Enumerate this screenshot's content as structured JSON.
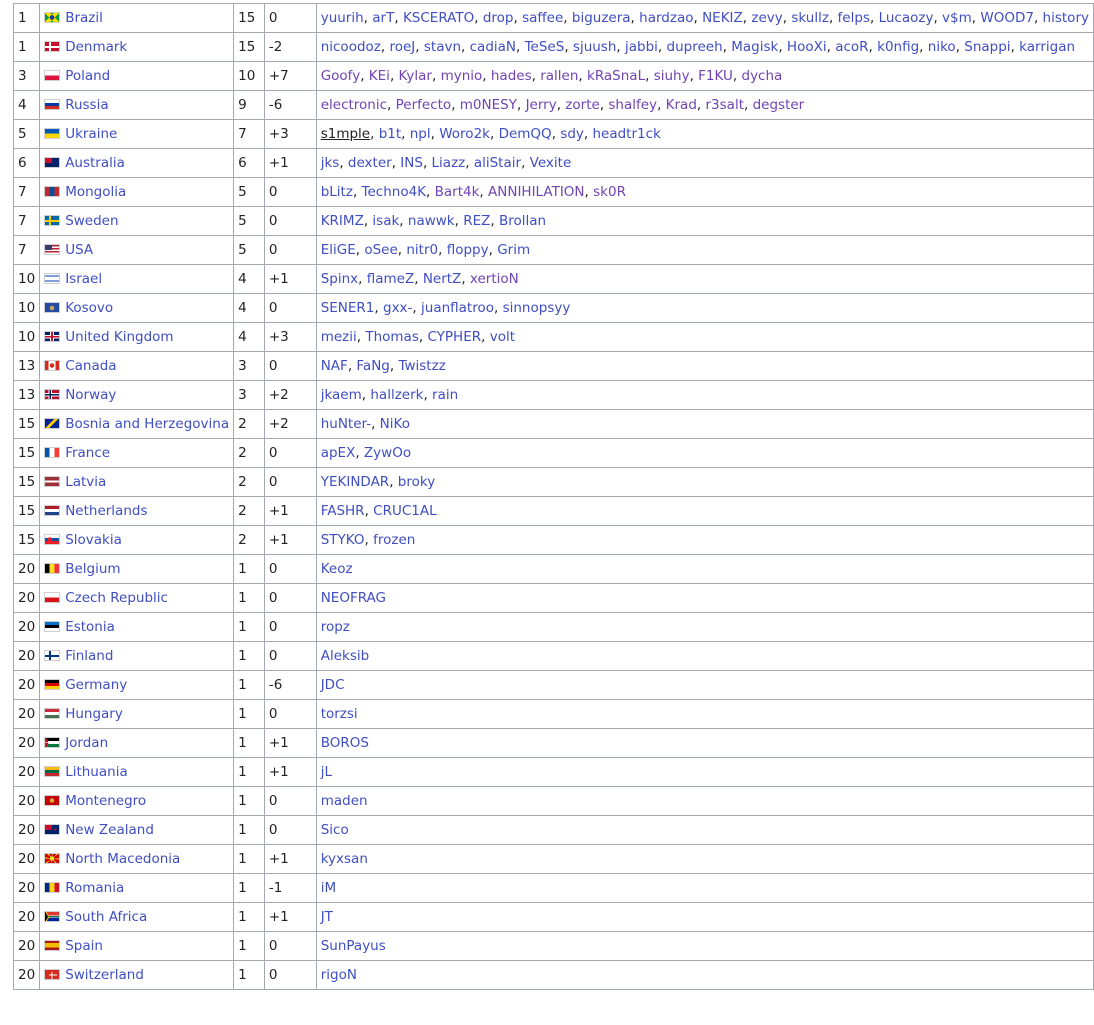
{
  "rows": [
    {
      "rank": "1",
      "country": "Brazil",
      "count": "15",
      "change": "0",
      "flag": "br",
      "players": [
        {
          "name": "yuurih"
        },
        {
          "name": "arT"
        },
        {
          "name": "KSCERATO"
        },
        {
          "name": "drop"
        },
        {
          "name": "saffee"
        },
        {
          "name": "biguzera"
        },
        {
          "name": "hardzao"
        },
        {
          "name": "NEKIZ"
        },
        {
          "name": "zevy"
        },
        {
          "name": "skullz"
        },
        {
          "name": "felps"
        },
        {
          "name": "Lucaozy"
        },
        {
          "name": "v$m"
        },
        {
          "name": "WOOD7"
        },
        {
          "name": "history"
        }
      ]
    },
    {
      "rank": "1",
      "country": "Denmark",
      "count": "15",
      "change": "-2",
      "flag": "dk",
      "players": [
        {
          "name": "nicoodoz"
        },
        {
          "name": "roeJ"
        },
        {
          "name": "stavn"
        },
        {
          "name": "cadiaN"
        },
        {
          "name": "TeSeS"
        },
        {
          "name": "sjuush"
        },
        {
          "name": "jabbi"
        },
        {
          "name": "dupreeh"
        },
        {
          "name": "Magisk"
        },
        {
          "name": "HooXi"
        },
        {
          "name": "acoR"
        },
        {
          "name": "k0nfig"
        },
        {
          "name": "niko"
        },
        {
          "name": "Snappi"
        },
        {
          "name": "karrigan"
        }
      ]
    },
    {
      "rank": "3",
      "country": "Poland",
      "count": "10",
      "change": "+7",
      "flag": "pl",
      "players": [
        {
          "name": "Goofy",
          "state": "visited"
        },
        {
          "name": "KEi",
          "state": "visited"
        },
        {
          "name": "Kylar",
          "state": "visited"
        },
        {
          "name": "mynio",
          "state": "visited"
        },
        {
          "name": "hades",
          "state": "visited"
        },
        {
          "name": "rallen",
          "state": "visited"
        },
        {
          "name": "kRaSnaL",
          "state": "visited"
        },
        {
          "name": "siuhy",
          "state": "visited"
        },
        {
          "name": "F1KU",
          "state": "visited"
        },
        {
          "name": "dycha",
          "state": "visited"
        }
      ]
    },
    {
      "rank": "4",
      "country": "Russia",
      "count": "9",
      "change": "-6",
      "flag": "ru",
      "players": [
        {
          "name": "electronic",
          "state": "visited"
        },
        {
          "name": "Perfecto",
          "state": "visited"
        },
        {
          "name": "m0NESY",
          "state": "visited"
        },
        {
          "name": "Jerry",
          "state": "visited"
        },
        {
          "name": "zorte",
          "state": "visited"
        },
        {
          "name": "shalfey",
          "state": "visited"
        },
        {
          "name": "Krad",
          "state": "visited"
        },
        {
          "name": "r3salt",
          "state": "visited"
        },
        {
          "name": "degster",
          "state": "visited"
        }
      ]
    },
    {
      "rank": "5",
      "country": "Ukraine",
      "count": "7",
      "change": "+3",
      "flag": "ua",
      "players": [
        {
          "name": "s1mple",
          "state": "hovered"
        },
        {
          "name": "b1t"
        },
        {
          "name": "npl"
        },
        {
          "name": "Woro2k"
        },
        {
          "name": "DemQQ"
        },
        {
          "name": "sdy"
        },
        {
          "name": "headtr1ck"
        }
      ]
    },
    {
      "rank": "6",
      "country": "Australia",
      "count": "6",
      "change": "+1",
      "flag": "au",
      "players": [
        {
          "name": "jks"
        },
        {
          "name": "dexter"
        },
        {
          "name": "INS"
        },
        {
          "name": "Liazz"
        },
        {
          "name": "aliStair"
        },
        {
          "name": "Vexite"
        }
      ]
    },
    {
      "rank": "7",
      "country": "Mongolia",
      "count": "5",
      "change": "0",
      "flag": "mn",
      "players": [
        {
          "name": "bLitz"
        },
        {
          "name": "Techno4K"
        },
        {
          "name": "Bart4k",
          "state": "visited"
        },
        {
          "name": "ANNIHILATION",
          "state": "visited"
        },
        {
          "name": "sk0R",
          "state": "visited"
        }
      ]
    },
    {
      "rank": "7",
      "country": "Sweden",
      "count": "5",
      "change": "0",
      "flag": "se",
      "players": [
        {
          "name": "KRIMZ"
        },
        {
          "name": "isak"
        },
        {
          "name": "nawwk"
        },
        {
          "name": "REZ"
        },
        {
          "name": "Brollan"
        }
      ]
    },
    {
      "rank": "7",
      "country": "USA",
      "count": "5",
      "change": "0",
      "flag": "us",
      "players": [
        {
          "name": "EliGE"
        },
        {
          "name": "oSee"
        },
        {
          "name": "nitr0"
        },
        {
          "name": "floppy"
        },
        {
          "name": "Grim"
        }
      ]
    },
    {
      "rank": "10",
      "country": "Israel",
      "count": "4",
      "change": "+1",
      "flag": "il",
      "players": [
        {
          "name": "Spinx"
        },
        {
          "name": "flameZ"
        },
        {
          "name": "NertZ"
        },
        {
          "name": "xertioN",
          "state": "visited"
        }
      ]
    },
    {
      "rank": "10",
      "country": "Kosovo",
      "count": "4",
      "change": "0",
      "flag": "xk",
      "players": [
        {
          "name": "SENER1"
        },
        {
          "name": "gxx-"
        },
        {
          "name": "juanflatroo"
        },
        {
          "name": "sinnopsyy"
        }
      ]
    },
    {
      "rank": "10",
      "country": "United Kingdom",
      "count": "4",
      "change": "+3",
      "flag": "gb",
      "players": [
        {
          "name": "mezii"
        },
        {
          "name": "Thomas"
        },
        {
          "name": "CYPHER"
        },
        {
          "name": "volt"
        }
      ]
    },
    {
      "rank": "13",
      "country": "Canada",
      "count": "3",
      "change": "0",
      "flag": "ca",
      "players": [
        {
          "name": "NAF"
        },
        {
          "name": "FaNg"
        },
        {
          "name": "Twistzz"
        }
      ]
    },
    {
      "rank": "13",
      "country": "Norway",
      "count": "3",
      "change": "+2",
      "flag": "no",
      "players": [
        {
          "name": "jkaem"
        },
        {
          "name": "hallzerk"
        },
        {
          "name": "rain"
        }
      ]
    },
    {
      "rank": "15",
      "country": "Bosnia and Herzegovina",
      "count": "2",
      "change": "+2",
      "flag": "ba",
      "players": [
        {
          "name": "huNter-"
        },
        {
          "name": "NiKo"
        }
      ]
    },
    {
      "rank": "15",
      "country": "France",
      "count": "2",
      "change": "0",
      "flag": "fr",
      "players": [
        {
          "name": "apEX"
        },
        {
          "name": "ZywOo"
        }
      ]
    },
    {
      "rank": "15",
      "country": "Latvia",
      "count": "2",
      "change": "0",
      "flag": "lv",
      "players": [
        {
          "name": "YEKINDAR"
        },
        {
          "name": "broky"
        }
      ]
    },
    {
      "rank": "15",
      "country": "Netherlands",
      "count": "2",
      "change": "+1",
      "flag": "nl",
      "players": [
        {
          "name": "FASHR"
        },
        {
          "name": "CRUC1AL"
        }
      ]
    },
    {
      "rank": "15",
      "country": "Slovakia",
      "count": "2",
      "change": "+1",
      "flag": "sk",
      "players": [
        {
          "name": "STYKO"
        },
        {
          "name": "frozen"
        }
      ]
    },
    {
      "rank": "20",
      "country": "Belgium",
      "count": "1",
      "change": "0",
      "flag": "be",
      "players": [
        {
          "name": "Keoz"
        }
      ]
    },
    {
      "rank": "20",
      "country": "Czech Republic",
      "count": "1",
      "change": "0",
      "flag": "cz",
      "players": [
        {
          "name": "NEOFRAG"
        }
      ]
    },
    {
      "rank": "20",
      "country": "Estonia",
      "count": "1",
      "change": "0",
      "flag": "ee",
      "players": [
        {
          "name": "ropz"
        }
      ]
    },
    {
      "rank": "20",
      "country": "Finland",
      "count": "1",
      "change": "0",
      "flag": "fi",
      "players": [
        {
          "name": "Aleksib"
        }
      ]
    },
    {
      "rank": "20",
      "country": "Germany",
      "count": "1",
      "change": "-6",
      "flag": "de",
      "players": [
        {
          "name": "JDC"
        }
      ]
    },
    {
      "rank": "20",
      "country": "Hungary",
      "count": "1",
      "change": "0",
      "flag": "hu",
      "players": [
        {
          "name": "torzsi"
        }
      ]
    },
    {
      "rank": "20",
      "country": "Jordan",
      "count": "1",
      "change": "+1",
      "flag": "jo",
      "players": [
        {
          "name": "BOROS"
        }
      ]
    },
    {
      "rank": "20",
      "country": "Lithuania",
      "count": "1",
      "change": "+1",
      "flag": "lt",
      "players": [
        {
          "name": "jL"
        }
      ]
    },
    {
      "rank": "20",
      "country": "Montenegro",
      "count": "1",
      "change": "0",
      "flag": "me",
      "players": [
        {
          "name": "maden"
        }
      ]
    },
    {
      "rank": "20",
      "country": "New Zealand",
      "count": "1",
      "change": "0",
      "flag": "nz",
      "players": [
        {
          "name": "Sico"
        }
      ]
    },
    {
      "rank": "20",
      "country": "North Macedonia",
      "count": "1",
      "change": "+1",
      "flag": "mk",
      "players": [
        {
          "name": "kyxsan"
        }
      ]
    },
    {
      "rank": "20",
      "country": "Romania",
      "count": "1",
      "change": "-1",
      "flag": "ro",
      "players": [
        {
          "name": "iM"
        }
      ]
    },
    {
      "rank": "20",
      "country": "South Africa",
      "count": "1",
      "change": "+1",
      "flag": "za",
      "players": [
        {
          "name": "JT"
        }
      ]
    },
    {
      "rank": "20",
      "country": "Spain",
      "count": "1",
      "change": "0",
      "flag": "es",
      "players": [
        {
          "name": "SunPayus"
        }
      ]
    },
    {
      "rank": "20",
      "country": "Switzerland",
      "count": "1",
      "change": "0",
      "flag": "ch",
      "players": [
        {
          "name": "rigoN"
        }
      ]
    }
  ],
  "colors": {
    "link": "#3f4ec2",
    "visited_link": "#6f44b4",
    "border": "#a2a9b1"
  }
}
